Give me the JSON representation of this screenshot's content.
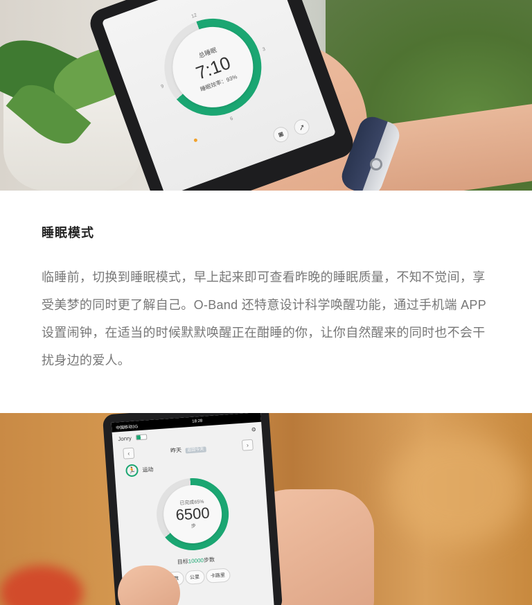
{
  "top_photo": {
    "phone_screen": {
      "dial_label": "总睡眠",
      "dial_time": "7:10",
      "dial_efficiency": "睡眠效率：93%",
      "dial_numbers": [
        "12",
        "3",
        "6",
        "9"
      ],
      "sleep_progress_fraction": 0.69,
      "buttons": [
        {
          "icon": "camera-icon",
          "glyph": "◙"
        },
        {
          "icon": "share-icon",
          "glyph": "➚"
        }
      ]
    }
  },
  "section": {
    "title": "睡眠模式",
    "body": "临睡前，切换到睡眠模式，早上起来即可查看昨晚的睡眠质量，不知不觉间，享受美梦的同时更了解自己。O-Band 还特意设计科学唤醒功能，通过手机端 APP 设置闹钟，在适当的时候默默唤醒正在酣睡的你，让你自然醒来的同时也不会干扰身边的爱人。"
  },
  "bottom_photo": {
    "phone_screen": {
      "status": {
        "carrier": "中国移动3G",
        "time": "18:28"
      },
      "user": "Jonry",
      "settings_icon": "⚙",
      "day": "昨天",
      "day_tag": "返回今天",
      "prev": "‹",
      "next": "›",
      "activity_label": "运动",
      "activity_icon": "🏃",
      "completed": "已完成65%",
      "steps": "6500",
      "steps_unit": "步",
      "goal_prefix": "目标",
      "goal_value": "10000",
      "goal_suffix": "步数",
      "progress_fraction": 0.65,
      "tabs": [
        "步数",
        "公里",
        "卡路里"
      ]
    }
  },
  "colors": {
    "accent": "#1ba672",
    "text_dark": "#222222",
    "text_body": "#777777"
  }
}
